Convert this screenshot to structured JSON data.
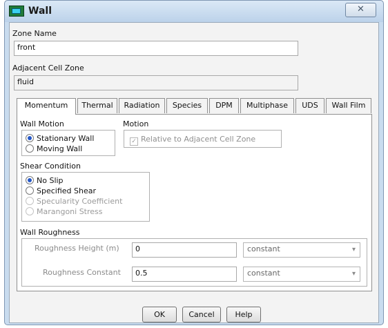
{
  "window": {
    "title": "Wall",
    "close_icon": "close-icon",
    "close_glyph": "✕"
  },
  "zone_name": {
    "label": "Zone Name",
    "value": "front"
  },
  "adjacent_cell_zone": {
    "label": "Adjacent Cell Zone",
    "value": "fluid"
  },
  "tabs": [
    {
      "label": "Momentum",
      "active": true
    },
    {
      "label": "Thermal"
    },
    {
      "label": "Radiation"
    },
    {
      "label": "Species"
    },
    {
      "label": "DPM"
    },
    {
      "label": "Multiphase"
    },
    {
      "label": "UDS"
    },
    {
      "label": "Wall Film"
    }
  ],
  "wall_motion": {
    "label": "Wall Motion",
    "options": [
      "Stationary Wall",
      "Moving Wall"
    ],
    "selected": "Stationary Wall"
  },
  "motion": {
    "label": "Motion",
    "checkbox_label": "Relative to Adjacent Cell Zone",
    "checkbox_checked": true,
    "check_glyph": "✓"
  },
  "shear_condition": {
    "label": "Shear Condition",
    "options": [
      "No Slip",
      "Specified Shear",
      "Specularity Coefficient",
      "Marangoni Stress"
    ],
    "selected": "No Slip"
  },
  "wall_roughness": {
    "label": "Wall Roughness",
    "height": {
      "label": "Roughness Height (m)",
      "value": "0",
      "method": "constant"
    },
    "constant": {
      "label": "Roughness Constant",
      "value": "0.5",
      "method": "constant"
    },
    "dropdown_glyph": "▾"
  },
  "buttons": {
    "ok": "OK",
    "cancel": "Cancel",
    "help": "Help"
  }
}
